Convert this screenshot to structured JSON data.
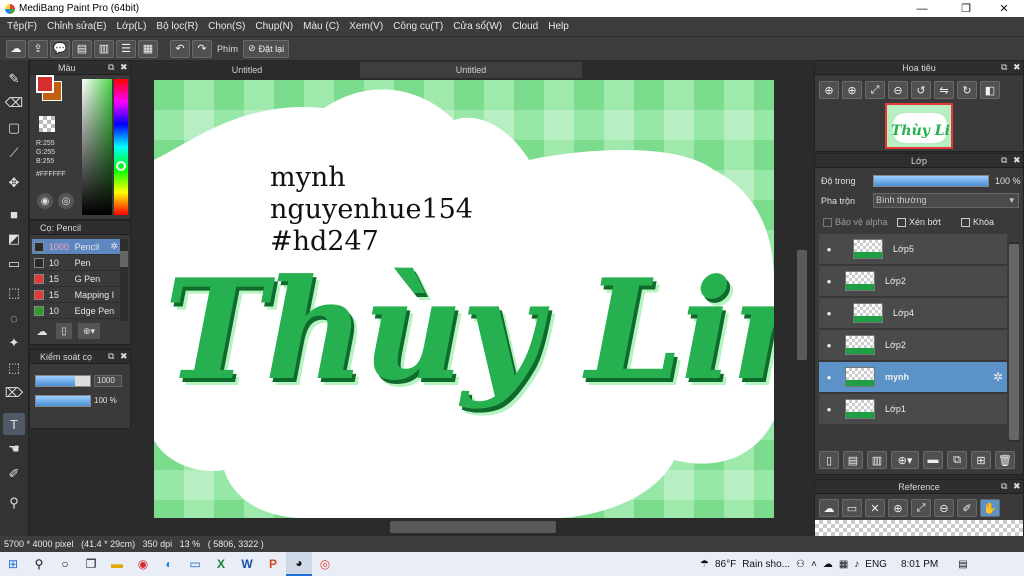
{
  "window": {
    "title": "MediBang Paint Pro (64bit)",
    "minimize": "—",
    "maximize": "❐",
    "close": "✕"
  },
  "menu": [
    "Tệp(F)",
    "Chỉnh sửa(E)",
    "Lớp(L)",
    "Bộ lọc(R)",
    "Chọn(S)",
    "Chụp(N)",
    "Màu (C)",
    "Xem(V)",
    "Công cụ(T)",
    "Cửa sổ(W)",
    "Cloud",
    "Help"
  ],
  "toolbar": {
    "shortcut_label": "Phím",
    "reset_label": "Đặt lại"
  },
  "color_panel": {
    "title": "Màu",
    "primary_color": "#d32f2f",
    "secondary_color": "#c06010",
    "rgb": {
      "r": "R:255",
      "g": "G:255",
      "b": "B:255"
    },
    "hex": "#FFFFFF"
  },
  "brush_panel": {
    "title": "Cọ: Pencil",
    "brushes": [
      {
        "size": "1000",
        "name": "Pencil",
        "color": "#2a2a2a",
        "selected": true
      },
      {
        "size": "10",
        "name": "Pen",
        "color": "#2a2a2a",
        "selected": false
      },
      {
        "size": "15",
        "name": "G Pen",
        "color": "#e53935",
        "selected": false
      },
      {
        "size": "15",
        "name": "Mapping I",
        "color": "#e53935",
        "selected": false
      },
      {
        "size": "10",
        "name": "Edge Pen",
        "color": "#2e9e2e",
        "selected": false
      }
    ]
  },
  "brush_control": {
    "title": "Kiểm soát cọ",
    "size_value": "1000",
    "size_fraction": 0.72,
    "opacity_value": "100 %",
    "opacity_fraction": 1.0
  },
  "tabs": [
    {
      "label": "Untitled",
      "active": false
    },
    {
      "label": "Untitled",
      "active": true
    }
  ],
  "canvas": {
    "line1": "mynh",
    "line2": "nguyenhue154",
    "line3": "#hd247",
    "lettering": "Thùy Linh"
  },
  "navigator": {
    "title": "Hoa tiêu"
  },
  "layer_panel": {
    "title": "Lớp",
    "opacity_label": "Độ trong",
    "opacity_value": "100 %",
    "opacity_fraction": 1.0,
    "blend_label": "Pha trộn",
    "blend_value": "Bình thường",
    "protect_alpha": "Bảo vệ alpha",
    "clipping": "Xén bớt",
    "lock": "Khóa",
    "layers": [
      {
        "name": "Lớp5",
        "selected": false,
        "indent": true
      },
      {
        "name": "Lớp2",
        "selected": false,
        "indent": false
      },
      {
        "name": "Lớp4",
        "selected": false,
        "indent": true
      },
      {
        "name": "Lớp2",
        "selected": false,
        "indent": false
      },
      {
        "name": "mynh",
        "selected": true,
        "indent": false
      },
      {
        "name": "Lớp1",
        "selected": false,
        "indent": false
      }
    ]
  },
  "reference_panel": {
    "title": "Reference"
  },
  "status": {
    "size": "5700 * 4000 pixel",
    "physical": "(41.4 * 29cm)",
    "dpi": "350 dpi",
    "zoom": "13 %",
    "coords": "( 5806, 3322 )"
  },
  "taskbar": {
    "weather_temp": "86°F",
    "weather_text": "Rain sho...",
    "language": "ENG",
    "time": "8:01 PM"
  },
  "colors": {
    "accent": "#5b93c9",
    "green_dark": "#1e9e45",
    "green_light": "#8fe59f"
  }
}
